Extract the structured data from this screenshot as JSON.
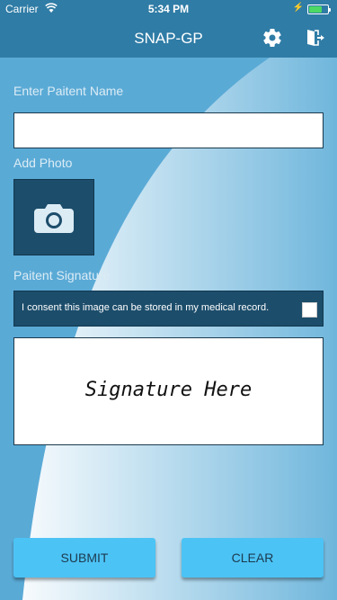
{
  "status_bar": {
    "carrier": "Carrier",
    "time": "5:34 PM",
    "battery_level": 0.7,
    "battery_color": "#4cd964"
  },
  "nav": {
    "title": "SNAP-GP",
    "settings_icon": "gear-icon",
    "logout_icon": "logout-icon"
  },
  "form": {
    "patient_name_label": "Enter Paitent Name",
    "patient_name_value": "",
    "add_photo_label": "Add Photo",
    "photo_icon": "camera-icon",
    "signature_label": "Paitent Signature",
    "consent_text": "I consent this image can be stored in my medical record.",
    "consent_checked": false,
    "signature_placeholder": "Signature Here"
  },
  "actions": {
    "submit_label": "SUBMIT",
    "clear_label": "CLEAR"
  },
  "colors": {
    "primary": "#2f7ca6",
    "dark_panel": "#1c4d6b",
    "button": "#4cc3f5"
  }
}
